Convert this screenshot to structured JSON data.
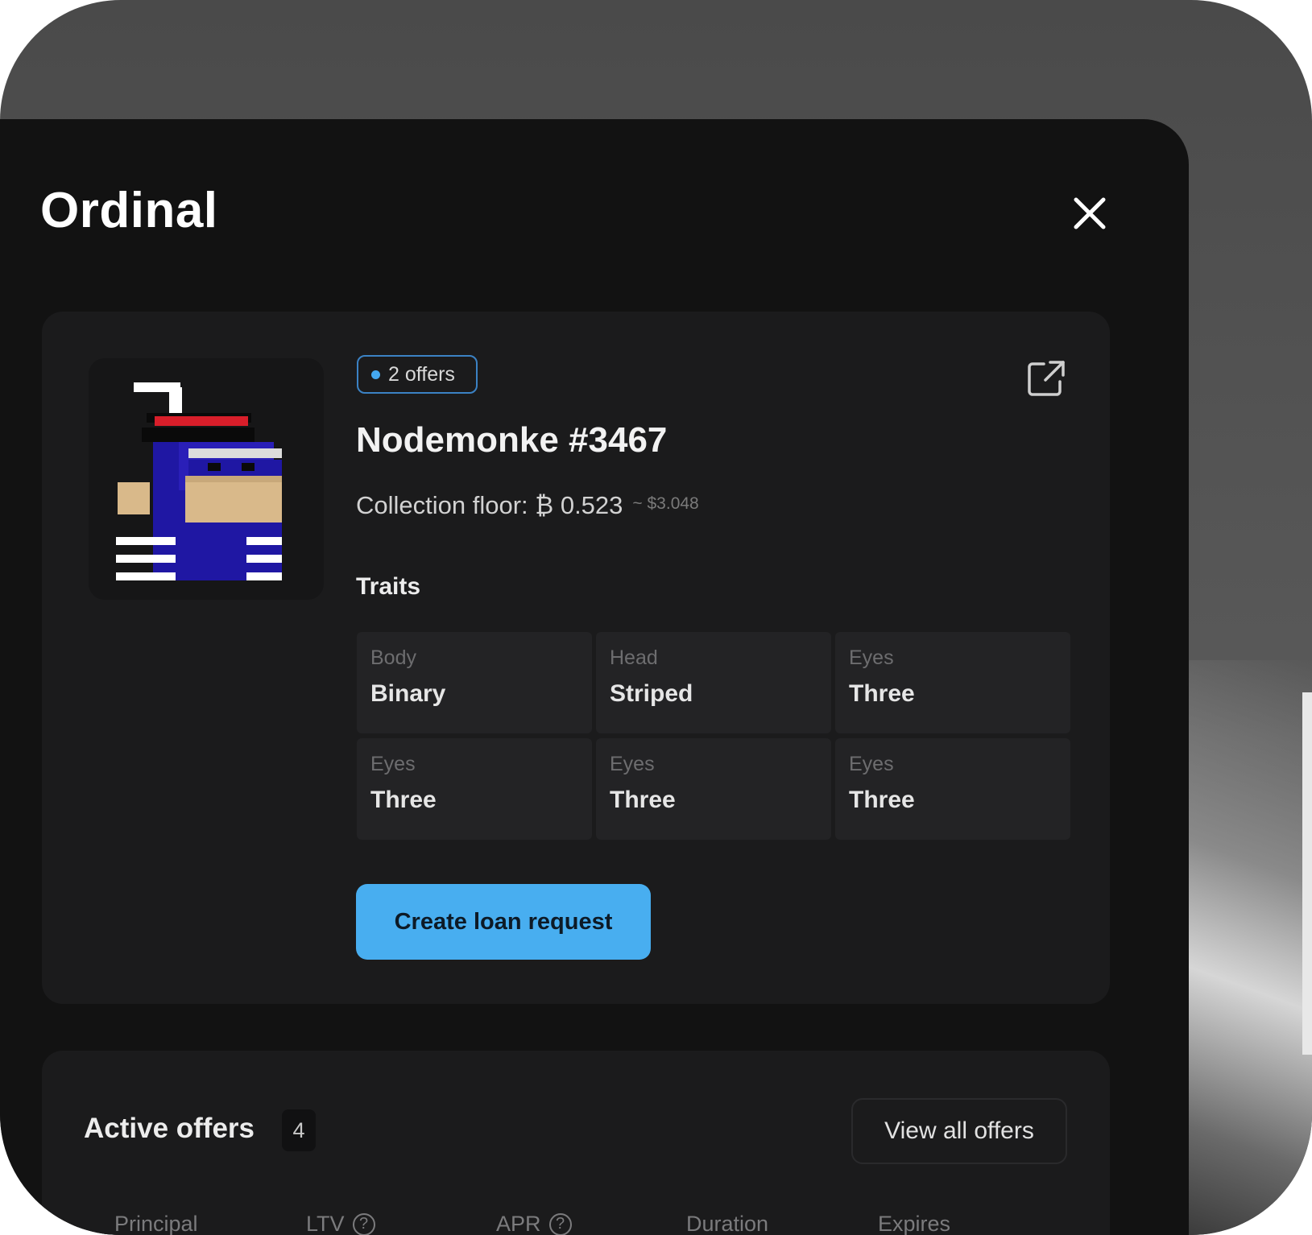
{
  "modal": {
    "title": "Ordinal",
    "close_icon": "close-icon"
  },
  "item": {
    "offers_badge": "2 offers",
    "name": "Nodemonke #3467",
    "floor_text": "Collection floor: ₿ 0.523",
    "floor_usd": "~ $3.048",
    "external_link_icon": "external-link-icon",
    "traits_label": "Traits",
    "traits": [
      {
        "name": "Body",
        "value": "Binary"
      },
      {
        "name": "Head",
        "value": "Striped"
      },
      {
        "name": "Eyes",
        "value": "Three"
      },
      {
        "name": "Eyes",
        "value": "Three"
      },
      {
        "name": "Eyes",
        "value": "Three"
      },
      {
        "name": "Eyes",
        "value": "Three"
      }
    ],
    "cta_label": "Create loan request"
  },
  "offers": {
    "title": "Active offers",
    "count": "4",
    "view_all_label": "View all offers",
    "columns": [
      "Principal",
      "LTV",
      "APR",
      "Duration",
      "Expires"
    ],
    "help_icon_glyph": "?"
  },
  "colors": {
    "accent": "#48aef0",
    "badge_border": "#3b82c4",
    "panel_bg": "#121212",
    "card_bg": "#1b1b1c"
  }
}
